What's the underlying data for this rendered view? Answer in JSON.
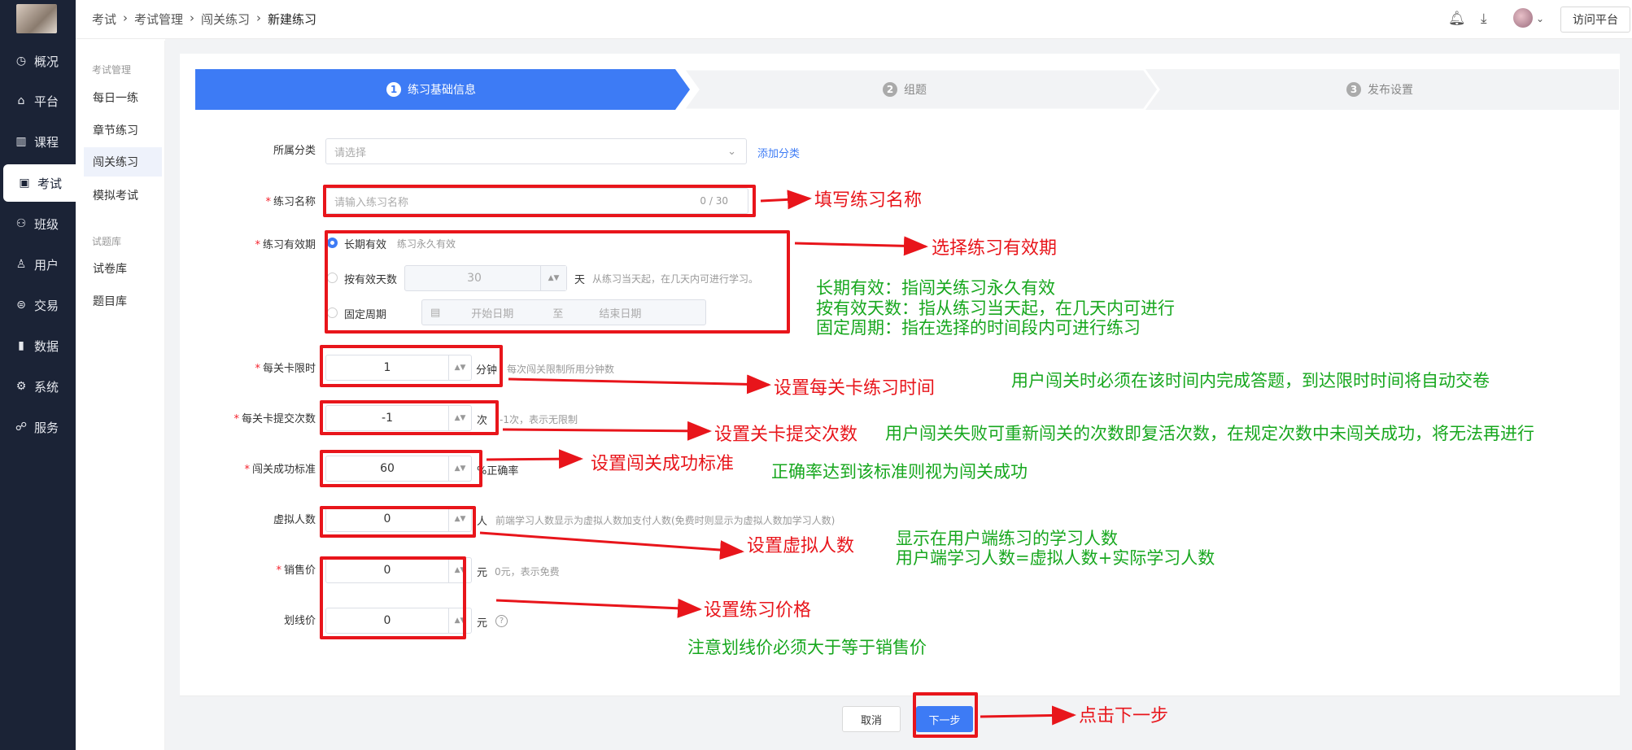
{
  "sidebar": {
    "items": [
      {
        "label": "概况",
        "icon": "dashboard-icon"
      },
      {
        "label": "平台",
        "icon": "platform-icon"
      },
      {
        "label": "课程",
        "icon": "book-icon"
      },
      {
        "label": "考试",
        "icon": "exam-icon"
      },
      {
        "label": "班级",
        "icon": "class-icon"
      },
      {
        "label": "用户",
        "icon": "user-icon"
      },
      {
        "label": "交易",
        "icon": "trade-icon"
      },
      {
        "label": "数据",
        "icon": "chart-icon"
      },
      {
        "label": "系统",
        "icon": "settings-icon"
      },
      {
        "label": "服务",
        "icon": "service-icon"
      }
    ]
  },
  "subnav": {
    "group1": "考试管理",
    "group1_items": [
      "每日一练",
      "章节练习",
      "闯关练习",
      "模拟考试"
    ],
    "group2": "试题库",
    "group2_items": [
      "试卷库",
      "题目库"
    ]
  },
  "breadcrumb": [
    "考试",
    "考试管理",
    "闯关练习",
    "新建练习"
  ],
  "topbar": {
    "visit_label": "访问平台"
  },
  "steps": [
    {
      "num": "1",
      "label": "练习基础信息"
    },
    {
      "num": "2",
      "label": "组题"
    },
    {
      "num": "3",
      "label": "发布设置"
    }
  ],
  "form": {
    "category": {
      "label": "所属分类",
      "placeholder": "请选择",
      "add_link": "添加分类"
    },
    "name": {
      "label": "练习名称",
      "placeholder": "请输入练习名称",
      "counter": "0 / 30"
    },
    "validity": {
      "label": "练习有效期",
      "opt1": "长期有效",
      "opt1_hint": "练习永久有效",
      "opt2": "按有效天数",
      "opt2_value": "30",
      "opt2_unit": "天",
      "opt2_hint": "从练习当天起，在几天内可进行学习。",
      "opt3": "固定周期",
      "start_placeholder": "开始日期",
      "to": "至",
      "end_placeholder": "结束日期"
    },
    "time_limit": {
      "label": "每关卡限时",
      "value": "1",
      "unit": "分钟",
      "hint": "每次闯关限制所用分钟数"
    },
    "submit_times": {
      "label": "每关卡提交次数",
      "value": "-1",
      "unit": "次",
      "hint": "-1次，表示无限制"
    },
    "pass_standard": {
      "label": "闯关成功标准",
      "value": "60",
      "unit": "%正确率"
    },
    "virtual_count": {
      "label": "虚拟人数",
      "value": "0",
      "unit": "人",
      "hint": "前端学习人数显示为虚拟人数加支付人数(免费时则显示为虚拟人数加学习人数)"
    },
    "price": {
      "label": "销售价",
      "value": "0",
      "unit": "元",
      "hint": "0元，表示免费"
    },
    "strike_price": {
      "label": "划线价",
      "value": "0",
      "unit": "元",
      "help": "?"
    }
  },
  "buttons": {
    "cancel": "取消",
    "next": "下一步"
  },
  "annotations": {
    "name": "填写练习名称",
    "validity": "选择练习有效期",
    "time_limit": "设置每关卡练习时间",
    "submit_times": "设置关卡提交次数",
    "pass_standard": "设置闯关成功标准",
    "virtual_count": "设置虚拟人数",
    "price": "设置练习价格",
    "next": "点击下一步"
  },
  "notes": {
    "validity1": "长期有效：指闯关练习永久有效",
    "validity2": "按有效天数：指从练习当天起，在几天内可进行",
    "validity3": "固定周期：指在选择的时间段内可进行练习",
    "time_limit": "用户闯关时必须在该时间内完成答题，到达限时时间将自动交卷",
    "submit_times": "用户闯关失败可重新闯关的次数即复活次数，在规定次数中未闯关成功，将无法再进行",
    "pass_standard": "正确率达到该标准则视为闯关成功",
    "virtual1": "显示在用户端练习的学习人数",
    "virtual2": "用户端学习人数=虚拟人数+实际学习人数",
    "strike": "注意划线价必须大于等于销售价"
  },
  "colors": {
    "sidebar": "#1b2336",
    "primary": "#3d7bf5",
    "annotation_red": "#e8151b",
    "annotation_green": "#17a71e"
  }
}
